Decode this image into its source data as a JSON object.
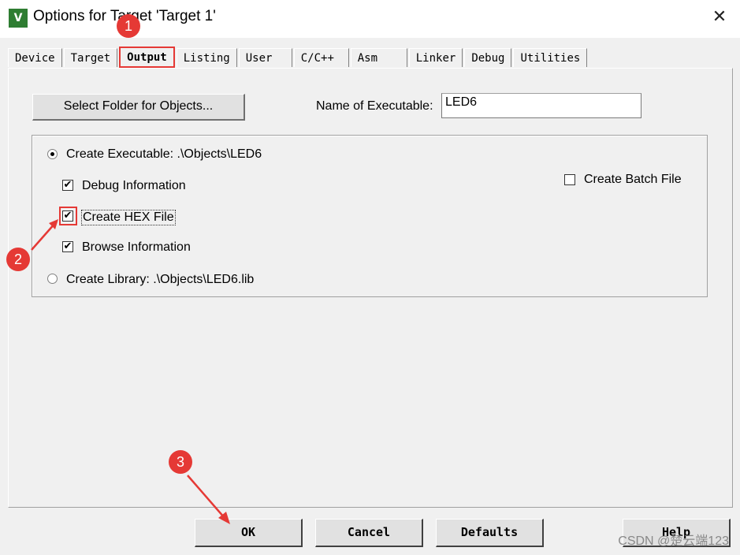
{
  "window": {
    "title": "Options for Target 'Target 1'",
    "app_icon": "keil-uvision-icon",
    "app_icon_text": "V"
  },
  "tabs": [
    {
      "label": "Device"
    },
    {
      "label": "Target"
    },
    {
      "label": "Output"
    },
    {
      "label": "Listing"
    },
    {
      "label": "User"
    },
    {
      "label": "C/C++"
    },
    {
      "label": "Asm"
    },
    {
      "label": "Linker"
    },
    {
      "label": "Debug"
    },
    {
      "label": "Utilities"
    }
  ],
  "active_tab": "Output",
  "output": {
    "select_folder_label": "Select Folder for Objects...",
    "name_label": "Name of Executable:",
    "name_value": "LED6",
    "create_executable_label": "Create Executable:  .\\Objects\\LED6",
    "create_executable_selected": true,
    "debug_info_label": "Debug Information",
    "debug_info_checked": true,
    "create_hex_label": "Create HEX File",
    "create_hex_checked": true,
    "browse_info_label": "Browse Information",
    "browse_info_checked": true,
    "create_library_label": "Create Library:  .\\Objects\\LED6.lib",
    "create_library_selected": false,
    "create_batch_label": "Create Batch File",
    "create_batch_checked": false
  },
  "buttons": {
    "ok": "OK",
    "cancel": "Cancel",
    "defaults": "Defaults",
    "help": "Help"
  },
  "annotations": {
    "step1": "1",
    "step2": "2",
    "step3": "3",
    "color": "#e53935"
  },
  "watermark": "CSDN @楚云端123"
}
